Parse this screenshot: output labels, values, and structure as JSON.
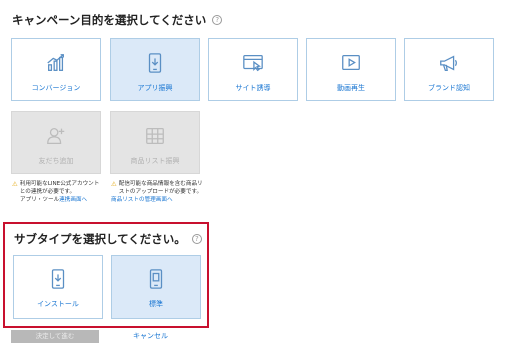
{
  "campaign": {
    "title": "キャンペーン目的を選択してください",
    "help": "?",
    "objectives": [
      {
        "label": "コンバージョン",
        "icon": "bar-chart-icon",
        "state": "normal"
      },
      {
        "label": "アプリ振興",
        "icon": "mobile-app-icon",
        "state": "selected"
      },
      {
        "label": "サイト誘導",
        "icon": "browser-cursor-icon",
        "state": "normal"
      },
      {
        "label": "動画再生",
        "icon": "play-icon",
        "state": "normal"
      },
      {
        "label": "ブランド認知",
        "icon": "megaphone-icon",
        "state": "normal"
      },
      {
        "label": "友だち追加",
        "icon": "add-friend-icon",
        "state": "disabled"
      },
      {
        "label": "商品リスト振興",
        "icon": "product-list-icon",
        "state": "disabled"
      }
    ],
    "notices": {
      "friends": {
        "warn": "⚠",
        "text": "利用可能なLINE公式アカウントとの連携が必要です。",
        "text2": "アプリ・ツール",
        "link": "連携画面へ"
      },
      "products": {
        "warn": "⚠",
        "text": "配信可能な商品情報を含む商品リストのアップロードが必要です。",
        "link": "商品リストの管理画面へ"
      }
    }
  },
  "subtype": {
    "title": "サブタイプを選択してください。",
    "help": "?",
    "options": [
      {
        "label": "インストール",
        "icon": "install-icon",
        "state": "normal"
      },
      {
        "label": "標準",
        "icon": "app-standard-icon",
        "state": "selected"
      }
    ]
  },
  "footer": {
    "submit_label": "決定して進む",
    "cancel_label": "キャンセル"
  },
  "colors": {
    "accent": "#1976d2",
    "selected_bg": "#dbe9f8",
    "card_border": "#aecde6",
    "disabled_bg": "#e4e4e4",
    "highlight_border": "#c8102e",
    "warning": "#e3a400"
  }
}
